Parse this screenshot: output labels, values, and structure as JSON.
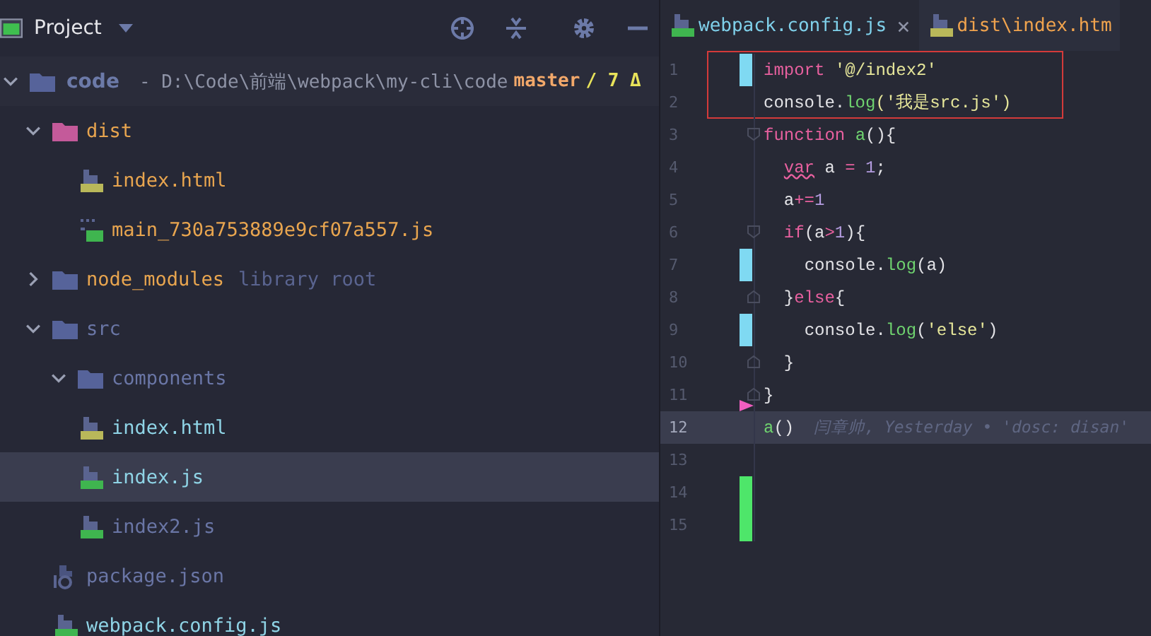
{
  "project_panel": {
    "title": "Project",
    "root": {
      "name": "code",
      "path": " - D:\\Code\\前端\\webpack\\my-cli\\code",
      "branch": "master",
      "changes": "/ 7 Δ",
      "expanded": true
    },
    "tree": [
      {
        "name": "dist",
        "kind": "excluded",
        "color": "#e8a54f",
        "expanded": true,
        "selected": false,
        "children": [
          {
            "name": "index.html",
            "kind": "html",
            "color": "#e8a54f",
            "selected": false
          },
          {
            "name": "main_730a753889e9cf07a557.js",
            "kind": "binary",
            "color": "#e8a54f",
            "selected": false
          }
        ]
      },
      {
        "name": "node_modules",
        "kind": "folder",
        "color": "#e8a54f",
        "note": "library root",
        "expanded": false,
        "selected": false
      },
      {
        "name": "src",
        "kind": "folder",
        "color": "#6a76a6",
        "expanded": true,
        "selected": false,
        "children": [
          {
            "name": "components",
            "kind": "folder",
            "color": "#6a76a6",
            "expanded": true,
            "selected": false
          },
          {
            "name": "index.html",
            "kind": "html",
            "color": "#8fd4e6",
            "selected": false
          },
          {
            "name": "index.js",
            "kind": "js",
            "color": "#8fd4e6",
            "selected": true
          },
          {
            "name": "index2.js",
            "kind": "js",
            "color": "#6a76a6",
            "selected": false
          }
        ]
      },
      {
        "name": "package.json",
        "kind": "json",
        "color": "#6a76a6",
        "selected": false
      },
      {
        "name": "webpack.config.js",
        "kind": "js",
        "color": "#8fd4e6",
        "selected": false
      }
    ]
  },
  "editor": {
    "tabs": [
      {
        "label": "webpack.config.js",
        "kind": "js",
        "selected": true,
        "close": "×"
      },
      {
        "label": "dist\\index.htm",
        "kind": "html",
        "selected": false
      }
    ],
    "lines": [
      {
        "number": "1",
        "kind": "modified",
        "boxed": true,
        "tokens": [
          {
            "text": "import ",
            "color": "#e8609f"
          },
          {
            "text": "'@/index2'",
            "color": "#e6e69a"
          }
        ]
      },
      {
        "number": "2",
        "kind": "plain",
        "boxed": true,
        "tokens": [
          {
            "text": "console.",
            "color": "#e2e2e6"
          },
          {
            "text": "log",
            "color": "#6fd36f"
          },
          {
            "text": "('我是src.js')",
            "color": "#e6e69a"
          }
        ]
      },
      {
        "number": "3",
        "kind": "plain",
        "fold_start": true,
        "tokens": [
          {
            "text": "function ",
            "color": "#e8609f"
          },
          {
            "text": "a",
            "color": "#6fd36f"
          },
          {
            "text": "(){",
            "color": "#e2e2e6"
          }
        ]
      },
      {
        "number": "4",
        "kind": "plain",
        "tokens": [
          {
            "text": "  var",
            "color": "#e8609f",
            "warning": true
          },
          {
            "text": " a ",
            "color": "#e2e2e6"
          },
          {
            "text": "=",
            "color": "#e8609f"
          },
          {
            "text": " 1",
            "color": "#b49ce0"
          },
          {
            "text": ";",
            "color": "#e2e2e6"
          }
        ]
      },
      {
        "number": "5",
        "kind": "plain",
        "tokens": [
          {
            "text": "  a",
            "color": "#e2e2e6"
          },
          {
            "text": "+=",
            "color": "#e8609f"
          },
          {
            "text": "1",
            "color": "#b49ce0"
          }
        ]
      },
      {
        "number": "6",
        "kind": "plain",
        "fold_start": true,
        "tokens": [
          {
            "text": "  if",
            "color": "#e8609f"
          },
          {
            "text": "(a",
            "color": "#e2e2e6"
          },
          {
            "text": ">",
            "color": "#e8609f"
          },
          {
            "text": "1",
            "color": "#b49ce0"
          },
          {
            "text": "){",
            "color": "#e2e2e6"
          }
        ]
      },
      {
        "number": "7",
        "kind": "modified",
        "tokens": [
          {
            "text": "    console.",
            "color": "#e2e2e6"
          },
          {
            "text": "log",
            "color": "#6fd36f"
          },
          {
            "text": "(a)",
            "color": "#e2e2e6"
          }
        ]
      },
      {
        "number": "8",
        "kind": "plain",
        "fold_end": true,
        "tokens": [
          {
            "text": "  }",
            "color": "#e2e2e6"
          },
          {
            "text": "else",
            "color": "#e8609f"
          },
          {
            "text": "{",
            "color": "#e2e2e6"
          }
        ]
      },
      {
        "number": "9",
        "kind": "modified",
        "tokens": [
          {
            "text": "    console.",
            "color": "#e2e2e6"
          },
          {
            "text": "log",
            "color": "#6fd36f"
          },
          {
            "text": "(",
            "color": "#e2e2e6"
          },
          {
            "text": "'else'",
            "color": "#e6e69a"
          },
          {
            "text": ")",
            "color": "#e2e2e6"
          }
        ]
      },
      {
        "number": "10",
        "kind": "plain",
        "fold_end": true,
        "tokens": [
          {
            "text": "  }",
            "color": "#e2e2e6"
          }
        ]
      },
      {
        "number": "11",
        "kind": "deleted",
        "fold_end": true,
        "tokens": [
          {
            "text": "}",
            "color": "#e2e2e6"
          }
        ]
      },
      {
        "number": "12",
        "kind": "plain",
        "current": true,
        "blame": "闫章帅, Yesterday • 'dosc: disan'",
        "tokens": [
          {
            "text": "a",
            "color": "#6fd36f"
          },
          {
            "text": "()",
            "color": "#e2e2e6"
          }
        ]
      },
      {
        "number": "13",
        "kind": "plain"
      },
      {
        "number": "14",
        "kind": "added"
      },
      {
        "number": "15",
        "kind": "added"
      }
    ]
  }
}
